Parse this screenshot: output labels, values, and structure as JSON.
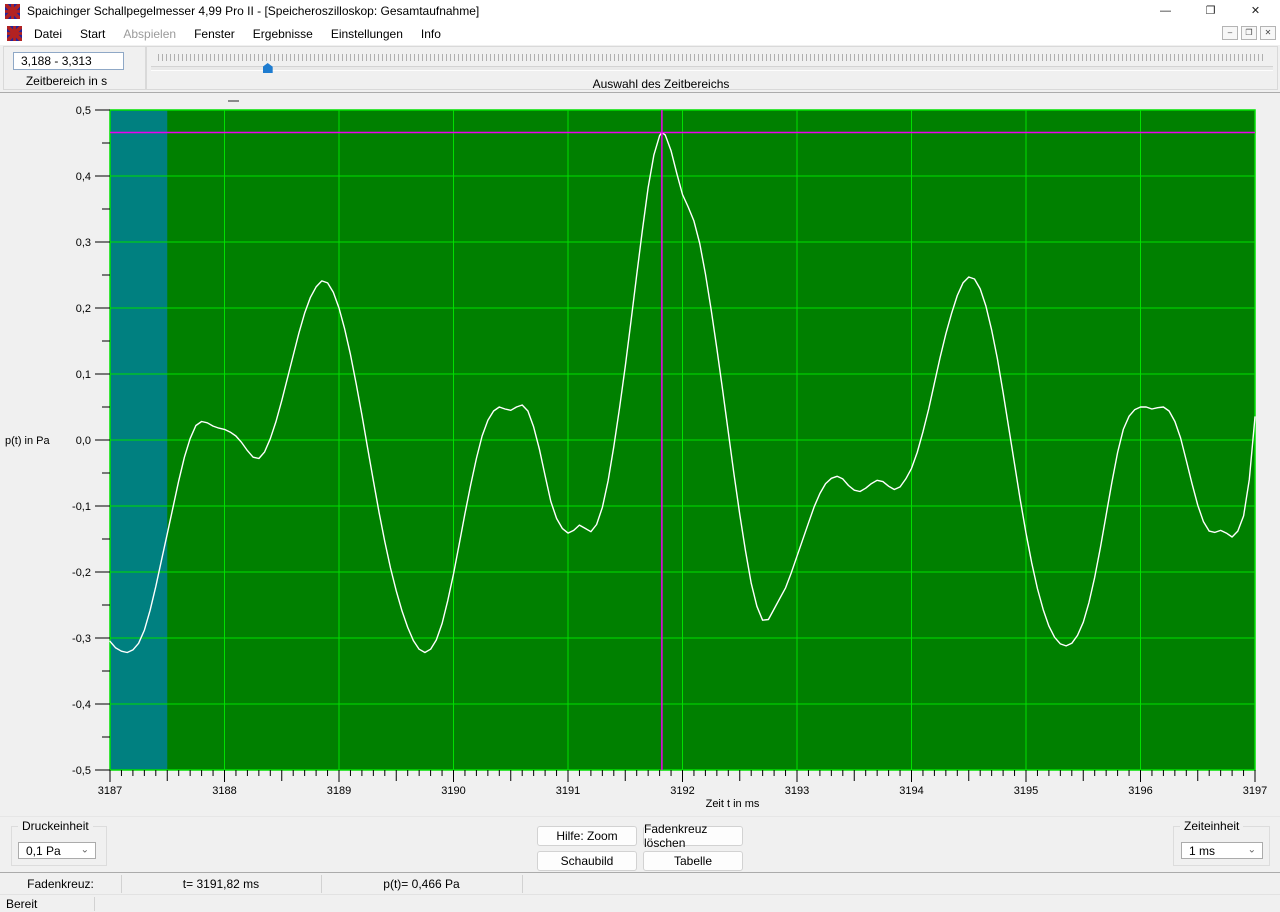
{
  "window": {
    "title": "Spaichinger Schallpegelmesser 4,99 Pro II - [Speicheroszilloskop: Gesamtaufnahme]",
    "minimize_glyph": "—",
    "restore_glyph": "❐",
    "close_glyph": "✕",
    "status_ready": "Bereit"
  },
  "menu": {
    "items": [
      {
        "label": "Datei",
        "enabled": true
      },
      {
        "label": "Start",
        "enabled": true
      },
      {
        "label": "Abspielen",
        "enabled": false
      },
      {
        "label": "Fenster",
        "enabled": true
      },
      {
        "label": "Ergebnisse",
        "enabled": true
      },
      {
        "label": "Einstellungen",
        "enabled": true
      },
      {
        "label": "Info",
        "enabled": true
      }
    ]
  },
  "toolbar": {
    "range_value": "3,188 - 3,313",
    "range_label": "Zeitbereich in s",
    "slider_label": "Auswahl des Zeitbereichs",
    "slider_fraction": 0.104
  },
  "chart_data": {
    "type": "line",
    "title": "",
    "xlabel": "Zeit t in ms",
    "ylabel": "p(t) in Pa",
    "xlim": [
      3187,
      3197
    ],
    "ylim": [
      -0.5,
      0.5
    ],
    "x_major_step": 1,
    "x_mid_step": 0.5,
    "x_minor_step": 0.1,
    "y_major_step": 0.1,
    "y_minor_step": 0.05,
    "grid": true,
    "legend_position": "top-left-dash",
    "x_tick_labels": [
      "3187",
      "3188",
      "3189",
      "3190",
      "3191",
      "3192",
      "3193",
      "3194",
      "3195",
      "3196",
      "3197"
    ],
    "y_tick_labels": [
      "0,5",
      "0,4",
      "0,3",
      "0,2",
      "0,1",
      "0,0",
      "-0,1",
      "-0,2",
      "-0,3",
      "-0,4",
      "-0,5"
    ],
    "colors": {
      "plot_bg": "#008000",
      "grid": "#00E000",
      "line": "#FFFFFF",
      "selection": "#008080",
      "crosshair": "#EE00EE",
      "axis_bg": "#F0F0F0"
    },
    "selection_band": {
      "x0": 3187.0,
      "x1": 3187.5
    },
    "crosshair": {
      "t": 3191.82,
      "p": 0.466
    },
    "series": [
      {
        "name": "p(t)",
        "points": [
          [
            3187.0,
            -0.305
          ],
          [
            3187.05,
            -0.315
          ],
          [
            3187.1,
            -0.32
          ],
          [
            3187.15,
            -0.322
          ],
          [
            3187.2,
            -0.318
          ],
          [
            3187.25,
            -0.308
          ],
          [
            3187.3,
            -0.288
          ],
          [
            3187.35,
            -0.258
          ],
          [
            3187.4,
            -0.222
          ],
          [
            3187.45,
            -0.182
          ],
          [
            3187.5,
            -0.142
          ],
          [
            3187.55,
            -0.102
          ],
          [
            3187.6,
            -0.062
          ],
          [
            3187.65,
            -0.026
          ],
          [
            3187.7,
            0.002
          ],
          [
            3187.75,
            0.022
          ],
          [
            3187.8,
            0.028
          ],
          [
            3187.85,
            0.026
          ],
          [
            3187.9,
            0.021
          ],
          [
            3187.95,
            0.018
          ],
          [
            3188.0,
            0.016
          ],
          [
            3188.05,
            0.012
          ],
          [
            3188.1,
            0.006
          ],
          [
            3188.15,
            -0.004
          ],
          [
            3188.2,
            -0.016
          ],
          [
            3188.25,
            -0.026
          ],
          [
            3188.3,
            -0.028
          ],
          [
            3188.35,
            -0.018
          ],
          [
            3188.4,
            0.002
          ],
          [
            3188.45,
            0.028
          ],
          [
            3188.5,
            0.06
          ],
          [
            3188.55,
            0.094
          ],
          [
            3188.6,
            0.128
          ],
          [
            3188.65,
            0.162
          ],
          [
            3188.7,
            0.192
          ],
          [
            3188.75,
            0.216
          ],
          [
            3188.8,
            0.232
          ],
          [
            3188.85,
            0.241
          ],
          [
            3188.9,
            0.238
          ],
          [
            3188.95,
            0.224
          ],
          [
            3189.0,
            0.2
          ],
          [
            3189.05,
            0.168
          ],
          [
            3189.1,
            0.13
          ],
          [
            3189.15,
            0.085
          ],
          [
            3189.2,
            0.038
          ],
          [
            3189.25,
            -0.012
          ],
          [
            3189.3,
            -0.062
          ],
          [
            3189.35,
            -0.11
          ],
          [
            3189.4,
            -0.154
          ],
          [
            3189.45,
            -0.194
          ],
          [
            3189.5,
            -0.229
          ],
          [
            3189.55,
            -0.259
          ],
          [
            3189.6,
            -0.284
          ],
          [
            3189.65,
            -0.304
          ],
          [
            3189.7,
            -0.317
          ],
          [
            3189.75,
            -0.322
          ],
          [
            3189.8,
            -0.317
          ],
          [
            3189.85,
            -0.303
          ],
          [
            3189.9,
            -0.278
          ],
          [
            3189.95,
            -0.243
          ],
          [
            3190.0,
            -0.203
          ],
          [
            3190.05,
            -0.158
          ],
          [
            3190.1,
            -0.112
          ],
          [
            3190.15,
            -0.068
          ],
          [
            3190.2,
            -0.028
          ],
          [
            3190.25,
            0.006
          ],
          [
            3190.3,
            0.03
          ],
          [
            3190.35,
            0.044
          ],
          [
            3190.4,
            0.05
          ],
          [
            3190.45,
            0.047
          ],
          [
            3190.5,
            0.045
          ],
          [
            3190.55,
            0.05
          ],
          [
            3190.6,
            0.053
          ],
          [
            3190.65,
            0.044
          ],
          [
            3190.7,
            0.02
          ],
          [
            3190.75,
            -0.014
          ],
          [
            3190.8,
            -0.054
          ],
          [
            3190.85,
            -0.093
          ],
          [
            3190.9,
            -0.119
          ],
          [
            3190.95,
            -0.134
          ],
          [
            3191.0,
            -0.141
          ],
          [
            3191.05,
            -0.137
          ],
          [
            3191.1,
            -0.129
          ],
          [
            3191.15,
            -0.134
          ],
          [
            3191.2,
            -0.139
          ],
          [
            3191.25,
            -0.128
          ],
          [
            3191.3,
            -0.102
          ],
          [
            3191.35,
            -0.062
          ],
          [
            3191.4,
            -0.01
          ],
          [
            3191.45,
            0.048
          ],
          [
            3191.5,
            0.112
          ],
          [
            3191.55,
            0.18
          ],
          [
            3191.6,
            0.25
          ],
          [
            3191.65,
            0.318
          ],
          [
            3191.7,
            0.382
          ],
          [
            3191.75,
            0.432
          ],
          [
            3191.8,
            0.461
          ],
          [
            3191.82,
            0.466
          ],
          [
            3191.85,
            0.462
          ],
          [
            3191.9,
            0.438
          ],
          [
            3191.95,
            0.404
          ],
          [
            3192.0,
            0.372
          ],
          [
            3192.05,
            0.353
          ],
          [
            3192.1,
            0.332
          ],
          [
            3192.15,
            0.298
          ],
          [
            3192.2,
            0.252
          ],
          [
            3192.25,
            0.198
          ],
          [
            3192.3,
            0.138
          ],
          [
            3192.35,
            0.076
          ],
          [
            3192.4,
            0.012
          ],
          [
            3192.45,
            -0.052
          ],
          [
            3192.5,
            -0.113
          ],
          [
            3192.55,
            -0.168
          ],
          [
            3192.6,
            -0.217
          ],
          [
            3192.65,
            -0.252
          ],
          [
            3192.7,
            -0.273
          ],
          [
            3192.75,
            -0.272
          ],
          [
            3192.8,
            -0.256
          ],
          [
            3192.85,
            -0.24
          ],
          [
            3192.9,
            -0.224
          ],
          [
            3192.95,
            -0.201
          ],
          [
            3193.0,
            -0.176
          ],
          [
            3193.05,
            -0.151
          ],
          [
            3193.1,
            -0.126
          ],
          [
            3193.15,
            -0.101
          ],
          [
            3193.2,
            -0.081
          ],
          [
            3193.25,
            -0.066
          ],
          [
            3193.3,
            -0.058
          ],
          [
            3193.35,
            -0.055
          ],
          [
            3193.4,
            -0.059
          ],
          [
            3193.45,
            -0.069
          ],
          [
            3193.5,
            -0.076
          ],
          [
            3193.55,
            -0.078
          ],
          [
            3193.6,
            -0.073
          ],
          [
            3193.65,
            -0.066
          ],
          [
            3193.7,
            -0.061
          ],
          [
            3193.75,
            -0.063
          ],
          [
            3193.8,
            -0.07
          ],
          [
            3193.85,
            -0.075
          ],
          [
            3193.9,
            -0.071
          ],
          [
            3193.95,
            -0.059
          ],
          [
            3194.0,
            -0.043
          ],
          [
            3194.05,
            -0.019
          ],
          [
            3194.1,
            0.012
          ],
          [
            3194.15,
            0.047
          ],
          [
            3194.2,
            0.086
          ],
          [
            3194.25,
            0.125
          ],
          [
            3194.3,
            0.161
          ],
          [
            3194.35,
            0.192
          ],
          [
            3194.4,
            0.219
          ],
          [
            3194.45,
            0.238
          ],
          [
            3194.5,
            0.247
          ],
          [
            3194.55,
            0.244
          ],
          [
            3194.6,
            0.229
          ],
          [
            3194.65,
            0.203
          ],
          [
            3194.7,
            0.167
          ],
          [
            3194.75,
            0.123
          ],
          [
            3194.8,
            0.072
          ],
          [
            3194.85,
            0.018
          ],
          [
            3194.9,
            -0.037
          ],
          [
            3194.95,
            -0.091
          ],
          [
            3195.0,
            -0.141
          ],
          [
            3195.05,
            -0.186
          ],
          [
            3195.1,
            -0.225
          ],
          [
            3195.15,
            -0.257
          ],
          [
            3195.2,
            -0.282
          ],
          [
            3195.25,
            -0.299
          ],
          [
            3195.3,
            -0.309
          ],
          [
            3195.35,
            -0.312
          ],
          [
            3195.4,
            -0.308
          ],
          [
            3195.45,
            -0.296
          ],
          [
            3195.5,
            -0.276
          ],
          [
            3195.55,
            -0.246
          ],
          [
            3195.6,
            -0.208
          ],
          [
            3195.65,
            -0.163
          ],
          [
            3195.7,
            -0.114
          ],
          [
            3195.75,
            -0.064
          ],
          [
            3195.8,
            -0.019
          ],
          [
            3195.85,
            0.016
          ],
          [
            3195.9,
            0.036
          ],
          [
            3195.95,
            0.046
          ],
          [
            3196.0,
            0.05
          ],
          [
            3196.05,
            0.05
          ],
          [
            3196.1,
            0.047
          ],
          [
            3196.15,
            0.049
          ],
          [
            3196.2,
            0.05
          ],
          [
            3196.25,
            0.044
          ],
          [
            3196.3,
            0.028
          ],
          [
            3196.35,
            0.003
          ],
          [
            3196.4,
            -0.031
          ],
          [
            3196.45,
            -0.066
          ],
          [
            3196.5,
            -0.099
          ],
          [
            3196.55,
            -0.124
          ],
          [
            3196.6,
            -0.138
          ],
          [
            3196.65,
            -0.14
          ],
          [
            3196.7,
            -0.137
          ],
          [
            3196.75,
            -0.141
          ],
          [
            3196.8,
            -0.147
          ],
          [
            3196.85,
            -0.138
          ],
          [
            3196.9,
            -0.115
          ],
          [
            3196.95,
            -0.06
          ],
          [
            3197.0,
            0.035
          ]
        ]
      }
    ]
  },
  "controls": {
    "druckeinheit_label": "Druckeinheit",
    "druckeinheit_value": "0,1 Pa",
    "zeiteinheit_label": "Zeiteinheit",
    "zeiteinheit_value": "1 ms",
    "combo_arrow": "⌄",
    "buttons": [
      {
        "label": "Hilfe: Zoom"
      },
      {
        "label": "Fadenkreuz löschen"
      },
      {
        "label": "Schaubild"
      },
      {
        "label": "Tabelle"
      }
    ]
  },
  "statusbar": {
    "crosshair_label": "Fadenkreuz:",
    "t_value": "t= 3191,82 ms",
    "p_value": "p(t)= 0,466 Pa"
  }
}
